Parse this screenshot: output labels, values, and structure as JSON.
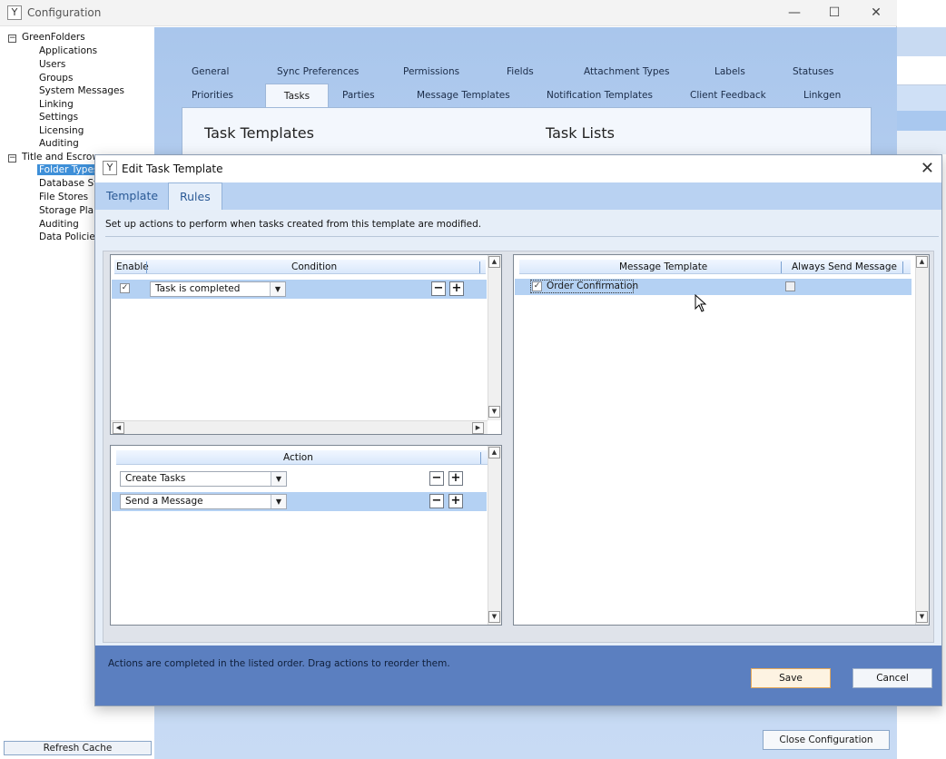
{
  "main_window": {
    "title": "Configuration",
    "icon_glyph": "Y",
    "controls": {
      "minimize": "—",
      "maximize": "☐",
      "close": "✕"
    }
  },
  "tree": {
    "groups": [
      {
        "toggle": "−",
        "label": "GreenFolders",
        "items": [
          "Applications",
          "Users",
          "Groups",
          "System Messages",
          "Linking",
          "Settings",
          "Licensing",
          "Auditing"
        ]
      },
      {
        "toggle": "−",
        "label": "Title and Escrow",
        "items": [
          "Folder Types",
          "Database Sto",
          "File Stores",
          "Storage Plan",
          "Auditing",
          "Data Policies"
        ]
      }
    ],
    "selected": "Folder Types"
  },
  "refresh_cache_label": "Refresh Cache",
  "config_tabs": {
    "row1": [
      "General",
      "Sync Preferences",
      "Permissions",
      "Fields",
      "Attachment Types",
      "Labels",
      "Statuses"
    ],
    "row2": [
      "Priorities",
      "Tasks",
      "Parties",
      "Message Templates",
      "Notification Templates",
      "Client Feedback",
      "Linkgen"
    ],
    "active": "Tasks"
  },
  "config_content": {
    "task_templates_heading": "Task Templates",
    "task_lists_heading": "Task Lists"
  },
  "close_configuration_label": "Close Configuration",
  "dialog": {
    "title": "Edit Task Template",
    "icon_glyph": "Y",
    "close_glyph": "✕",
    "tabs": [
      "Template",
      "Rules"
    ],
    "active_tab": "Rules",
    "description": "Set up actions to perform when tasks created from this template are modified.",
    "conditions": {
      "headers": {
        "enable": "Enable",
        "condition": "Condition"
      },
      "rows": [
        {
          "enabled": "✓",
          "condition": "Task is completed"
        }
      ]
    },
    "actions": {
      "header": "Action",
      "rows": [
        {
          "action": "Create Tasks"
        },
        {
          "action": "Send a Message"
        }
      ]
    },
    "messages": {
      "headers": {
        "template": "Message Template",
        "always_send": "Always Send Message"
      },
      "rows": [
        {
          "checked": "✓",
          "template": "Order Confirmation",
          "always_send": ""
        }
      ]
    },
    "glyphs": {
      "minus": "−",
      "plus": "+",
      "dropdown": "▼",
      "up": "▲",
      "down": "▼",
      "left": "◀",
      "right": "▶"
    },
    "footer_note": "Actions are completed in the listed order. Drag actions to reorder them.",
    "save_label": "Save",
    "cancel_label": "Cancel"
  },
  "colors": {
    "panel_blue": "#b9d1f1",
    "footer_blue": "#5b7fc0",
    "selected_row": "#b4d1f3",
    "tree_selected": "#3e8fd8",
    "save_border": "#e5a95a"
  }
}
